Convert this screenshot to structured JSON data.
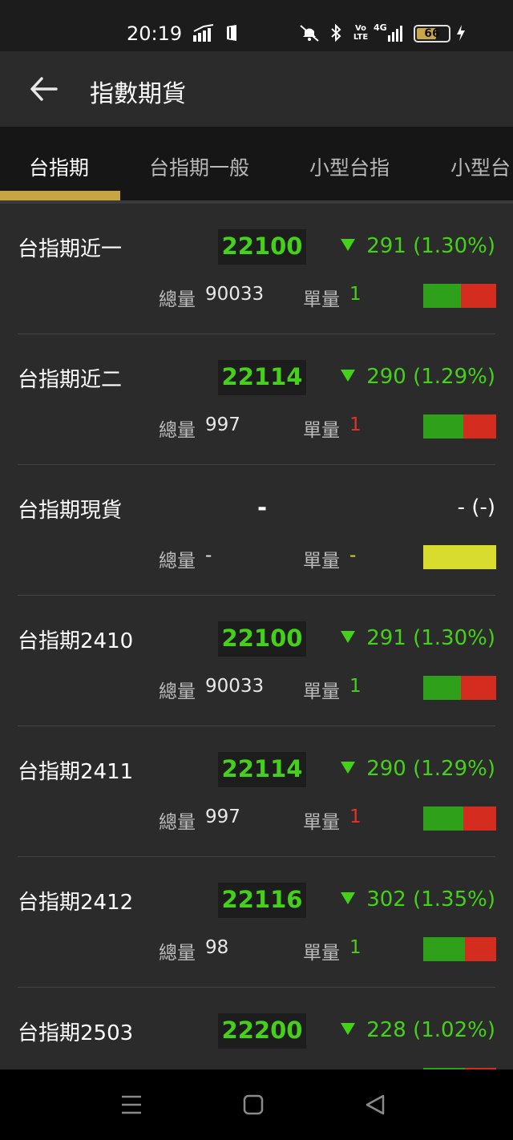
{
  "status_bar": {
    "time": "20:19",
    "battery": "66",
    "battery_level": 0.66,
    "network_label": "4G",
    "volte_label": "Vo LTE"
  },
  "header": {
    "title": "指數期貨",
    "back_icon": "arrow-left-icon"
  },
  "tabs": [
    {
      "label": "台指期",
      "active": true
    },
    {
      "label": "台指期一般",
      "active": false
    },
    {
      "label": "小型台指",
      "active": false
    },
    {
      "label": "小型台",
      "active": false
    }
  ],
  "labels": {
    "volume": "總量",
    "unit": "單量"
  },
  "colors": {
    "up": "#45d11a",
    "down_red": "#d62d20",
    "bar_green": "#2fa01a",
    "bar_red": "#d42d1f",
    "bar_yellow": "#d8dc2e",
    "accent": "#c7a545"
  },
  "rows": [
    {
      "name": "台指期近一",
      "price": "22100",
      "change": "291 (1.30%)",
      "direction": "down",
      "volume": "90033",
      "unit": "1",
      "unit_color": "#45d11a",
      "bar_green_fraction": 0.52
    },
    {
      "name": "台指期近二",
      "price": "22114",
      "change": "290 (1.29%)",
      "direction": "down",
      "volume": "997",
      "unit": "1",
      "unit_color": "#e0342a",
      "bar_green_fraction": 0.55
    },
    {
      "name": "台指期現貨",
      "price": "-",
      "change": "- (-)",
      "direction": "none",
      "volume": "-",
      "unit": "-",
      "unit_color": "#d8dc2e",
      "bar_green_fraction": null
    },
    {
      "name": "台指期2410",
      "price": "22100",
      "change": "291 (1.30%)",
      "direction": "down",
      "volume": "90033",
      "unit": "1",
      "unit_color": "#45d11a",
      "bar_green_fraction": 0.52
    },
    {
      "name": "台指期2411",
      "price": "22114",
      "change": "290 (1.29%)",
      "direction": "down",
      "volume": "997",
      "unit": "1",
      "unit_color": "#e0342a",
      "bar_green_fraction": 0.55
    },
    {
      "name": "台指期2412",
      "price": "22116",
      "change": "302 (1.35%)",
      "direction": "down",
      "volume": "98",
      "unit": "1",
      "unit_color": "#45d11a",
      "bar_green_fraction": 0.57
    },
    {
      "name": "台指期2503",
      "price": "22200",
      "change": "228 (1.02%)",
      "direction": "down",
      "volume": "",
      "unit": "",
      "unit_color": "#45d11a",
      "bar_green_fraction": 0.57
    }
  ],
  "nav": {
    "recents_icon": "menu-lines-icon",
    "home_icon": "home-square-icon",
    "back_icon": "back-triangle-icon"
  }
}
